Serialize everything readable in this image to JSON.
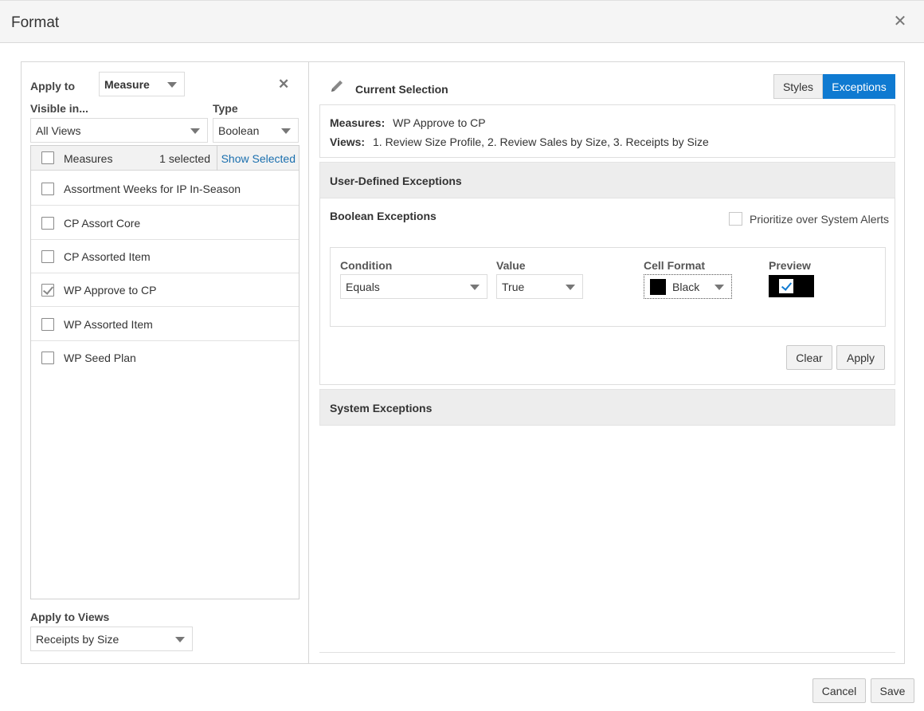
{
  "dialog": {
    "title": "Format"
  },
  "left": {
    "apply_to_label": "Apply to",
    "apply_to_value": "Measure",
    "visible_in_label": "Visible in...",
    "visible_in_value": "All Views",
    "type_label": "Type",
    "type_value": "Boolean",
    "list_header": "Measures",
    "selected_count": "1 selected",
    "show_selected": "Show Selected",
    "items": [
      {
        "label": "Assortment Weeks for IP In-Season",
        "checked": false
      },
      {
        "label": "CP Assort Core",
        "checked": false
      },
      {
        "label": "CP Assorted Item",
        "checked": false
      },
      {
        "label": "WP Approve to CP",
        "checked": true
      },
      {
        "label": "WP Assorted Item",
        "checked": false
      },
      {
        "label": "WP Seed Plan",
        "checked": false
      }
    ],
    "apply_to_views_label": "Apply to Views",
    "apply_to_views_value": "Receipts by Size"
  },
  "right": {
    "current_selection": "Current Selection",
    "tabs": {
      "styles": "Styles",
      "exceptions": "Exceptions"
    },
    "measures_key": "Measures:",
    "measures_value": "WP Approve to CP",
    "views_key": "Views:",
    "views_value": "1. Review Size Profile, 2. Review Sales by Size, 3. Receipts by Size",
    "user_defined": "User-Defined Exceptions",
    "boolean_exceptions": "Boolean Exceptions",
    "prioritize": "Prioritize over System Alerts",
    "condition_label": "Condition",
    "condition_value": "Equals",
    "value_label": "Value",
    "value_value": "True",
    "cell_format_label": "Cell Format",
    "cell_format_value": "Black",
    "preview_label": "Preview",
    "clear": "Clear",
    "apply": "Apply",
    "system_exceptions": "System Exceptions"
  },
  "footer": {
    "cancel": "Cancel",
    "save": "Save"
  },
  "colors": {
    "accent": "#0f7ad1",
    "swatch": "#000000",
    "link": "#1a6fae"
  }
}
